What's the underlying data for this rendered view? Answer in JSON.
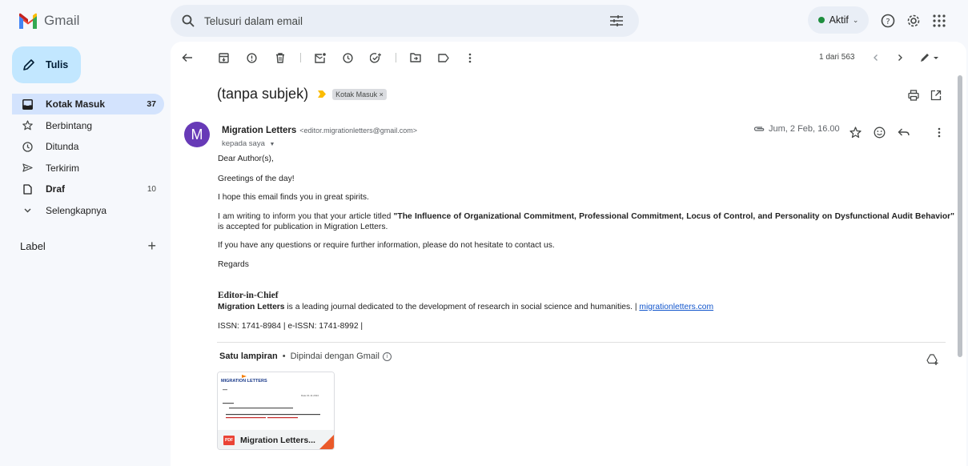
{
  "app": {
    "name": "Gmail",
    "brand_colors": {
      "red": "#ea4335",
      "blue": "#4285f4",
      "green": "#34a853",
      "yellow": "#fbbc04"
    }
  },
  "search": {
    "placeholder": "Telusuri dalam email"
  },
  "status": {
    "label": "Aktif",
    "color": "#1e8e3e"
  },
  "compose": {
    "label": "Tulis"
  },
  "sidebar": {
    "items": [
      {
        "label": "Kotak Masuk",
        "count": "37",
        "icon": "inbox-icon",
        "active": true
      },
      {
        "label": "Berbintang",
        "count": "",
        "icon": "star-icon"
      },
      {
        "label": "Ditunda",
        "count": "",
        "icon": "clock-icon"
      },
      {
        "label": "Terkirim",
        "count": "",
        "icon": "send-icon"
      },
      {
        "label": "Draf",
        "count": "10",
        "icon": "draft-icon"
      },
      {
        "label": "Selengkapnya",
        "count": "",
        "icon": "chevron-down-icon"
      }
    ],
    "labels_header": "Label"
  },
  "toolbar": {
    "pager": "1 dari 563"
  },
  "email": {
    "subject": "(tanpa subjek)",
    "inbox_tag": "Kotak Masuk ×",
    "avatar_letter": "M",
    "sender_name": "Migration Letters",
    "sender_email": "<editor.migrationletters@gmail.com>",
    "to_line": "kepada saya",
    "date": "Jum, 2 Feb, 16.00",
    "body": {
      "greeting": "Dear Author(s),",
      "line2": "Greetings of the day!",
      "line3": "I hope this email finds you in great spirits.",
      "line4_pre": "I am writing to inform you that your article titled ",
      "line4_title": "\"The Influence of Organizational Commitment, Professional Commitment, Locus of Control, and Personality on Dysfunctional Audit Behavior\"",
      "line4_post": " is accepted for publication in Migration Letters.",
      "line5": "If you have any questions or require further information, please do not hesitate to contact us.",
      "line6": "Regards",
      "sig_title": "Editor-in-Chief",
      "sig_org": "Migration Letters",
      "sig_desc": " is a leading journal dedicated to the development of research in social science and humanities. | ",
      "sig_link": "migrationletters.com",
      "issn": "ISSN: 1741-8984 | e-ISSN: 1741-8992 |"
    }
  },
  "attachments": {
    "count_label": "Satu lampiran",
    "scan_label": "Dipindai dengan Gmail",
    "file_badge": "PDF",
    "file_name": "Migration Letters...",
    "preview_logo": "MIGRATION LETTERS",
    "preview_date": "Date 01.11.2024"
  }
}
